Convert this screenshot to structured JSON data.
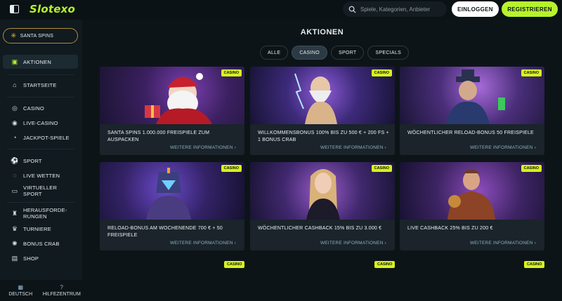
{
  "header": {
    "logo": "Slotexo",
    "search_placeholder": "Spiele, Kategorien, Anbieter",
    "login": "EINLOGGEN",
    "register": "REGISTRIEREN"
  },
  "sidebar": {
    "promo": "SANTA SPINS",
    "items": [
      {
        "label": "AKTIONEN",
        "icon": "gift-icon"
      },
      {
        "label": "STARTSEITE",
        "icon": "home-icon"
      },
      {
        "label": "CASINO",
        "icon": "casino-chip-icon"
      },
      {
        "label": "LIVE-CASINO",
        "icon": "live-icon"
      },
      {
        "label": "JACKPOT-SPIELE",
        "icon": "jackpot-icon"
      },
      {
        "label": "SPORT",
        "icon": "football-icon"
      },
      {
        "label": "LIVE WETTEN",
        "icon": "live-bet-icon"
      },
      {
        "label": "VIRTUELLER SPORT",
        "icon": "gamepad-icon"
      },
      {
        "label": "HERAUSFORDE-RUNGEN",
        "icon": "trophy-icon"
      },
      {
        "label": "TURNIERE",
        "icon": "tournament-icon"
      },
      {
        "label": "BONUS CRAB",
        "icon": "crab-icon"
      },
      {
        "label": "SHOP",
        "icon": "shop-icon"
      }
    ],
    "footer": {
      "language": "DEUTSCH",
      "help": "HILFEZENTRUM"
    }
  },
  "main": {
    "title": "AKTIONEN",
    "tabs": [
      "ALLE",
      "CASINO",
      "SPORT",
      "SPECIALS"
    ],
    "active_tab": "CASINO",
    "badge": "CASINO",
    "more_label": "WEITERE INFORMATIONEN",
    "cards": [
      {
        "title": "SANTA SPINS 1.000.000 FREISPIELE ZUM AUSPACKEN",
        "art": "santa"
      },
      {
        "title": "WILLKOMMENSBONUS 100% BIS ZU 500 € + 200 FS + 1 BONUS CRAB",
        "art": "zeus"
      },
      {
        "title": "WÖCHENTLICHER RELOAD-BONUS 50 FREISPIELE",
        "art": "gangster"
      },
      {
        "title": "RELOAD-BONUS AM WOCHENENDE 700 € + 50 FREISPIELE",
        "art": "robot"
      },
      {
        "title": "WÖCHENTLICHER CASHBACK 15% BIS ZU 3.000 €",
        "art": "woman"
      },
      {
        "title": "LIVE CASHBACK 25% BIS ZU 200 €",
        "art": "warrior"
      }
    ]
  }
}
